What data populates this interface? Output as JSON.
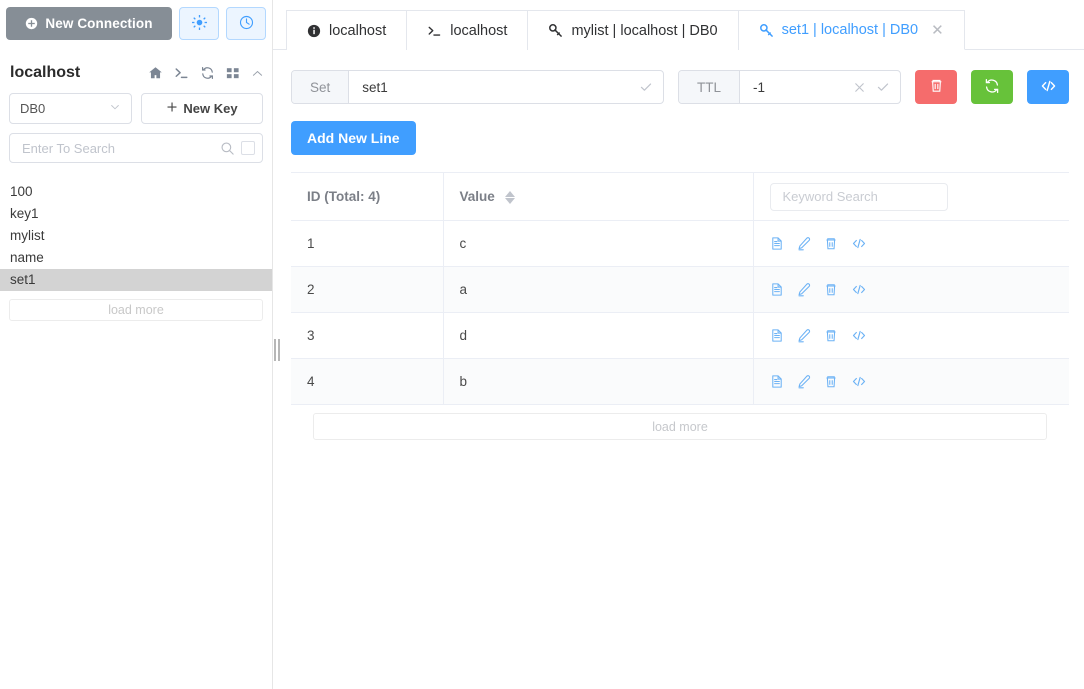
{
  "sidebar": {
    "new_connection_label": "New Connection",
    "icon_buttons": [
      {
        "name": "settings-button",
        "icon": "sun-icon"
      },
      {
        "name": "history-button",
        "icon": "clock-icon"
      }
    ],
    "host_name": "localhost",
    "host_icons": [
      "home-icon",
      "terminal-icon",
      "refresh-icon",
      "grid-icon",
      "chevron-up-icon"
    ],
    "db_selected": "DB0",
    "new_key_label": "New Key",
    "search_placeholder": "Enter To Search",
    "search_value": "",
    "keys": [
      "100",
      "key1",
      "mylist",
      "name",
      "set1"
    ],
    "active_key": "set1",
    "load_more_label": "load more"
  },
  "tabs": [
    {
      "label": "localhost",
      "icon": "info-icon",
      "active": false,
      "closable": false
    },
    {
      "label": "localhost",
      "icon": "terminal-icon",
      "active": false,
      "closable": false
    },
    {
      "label": "mylist | localhost | DB0",
      "icon": "key-icon",
      "active": false,
      "closable": false
    },
    {
      "label": "set1 | localhost | DB0",
      "icon": "key-icon",
      "active": true,
      "closable": true
    }
  ],
  "toolbar": {
    "key_type_label": "Set",
    "key_name_value": "set1",
    "ttl_label": "TTL",
    "ttl_value": "-1",
    "delete_button": "delete-icon",
    "refresh_button": "refresh-icon",
    "code_button": "code-icon",
    "add_new_line_label": "Add New Line"
  },
  "table": {
    "columns": [
      "ID (Total: 4)",
      "Value",
      ""
    ],
    "keyword_placeholder": "Keyword Search",
    "keyword_value": "",
    "rows": [
      {
        "id": "1",
        "value": "c"
      },
      {
        "id": "2",
        "value": "a"
      },
      {
        "id": "3",
        "value": "d"
      },
      {
        "id": "4",
        "value": "b"
      }
    ],
    "row_actions": [
      "detail-icon",
      "edit-icon",
      "delete-icon",
      "code-icon"
    ],
    "load_more_label": "load more"
  },
  "colors": {
    "accent": "#409eff",
    "danger": "#f56c6c",
    "success": "#67c23a",
    "neutral": "#868e96"
  }
}
